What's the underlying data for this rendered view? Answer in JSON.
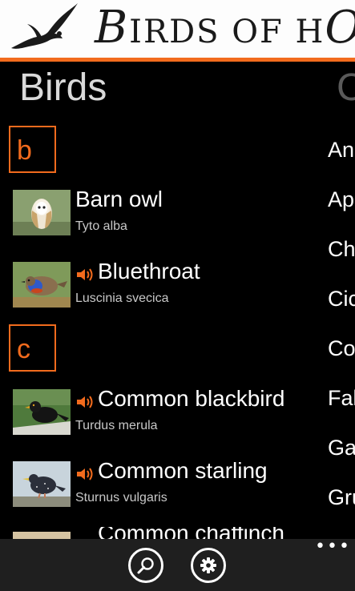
{
  "banner": {
    "title_initial": "B",
    "title_rest": "IRDS OF H",
    "title_initial2": "O"
  },
  "pivot": {
    "current": "Birds",
    "next": "C"
  },
  "groups": [
    {
      "letter": "b",
      "birds": [
        {
          "name": "Barn owl",
          "latin": "Tyto alba",
          "has_sound": false
        },
        {
          "name": "Bluethroat",
          "latin": "Luscinia svecica",
          "has_sound": true
        }
      ]
    },
    {
      "letter": "c",
      "birds": [
        {
          "name": "Common blackbird",
          "latin": "Turdus merula",
          "has_sound": true
        },
        {
          "name": "Common starling",
          "latin": "Sturnus vulgaris",
          "has_sound": true
        },
        {
          "name": "Common chaffinch",
          "latin": "",
          "has_sound": true
        }
      ]
    }
  ],
  "categories": [
    "An",
    "Ap",
    "Ch",
    "Cic",
    "Co",
    "Fal",
    "Ga",
    "Gru"
  ],
  "app_bar": {
    "search_icon": "search-icon",
    "settings_icon": "gear-icon",
    "more": "•••"
  },
  "colors": {
    "accent": "#f26b1d",
    "background": "#000000",
    "app_bar": "#1f1f1f"
  }
}
